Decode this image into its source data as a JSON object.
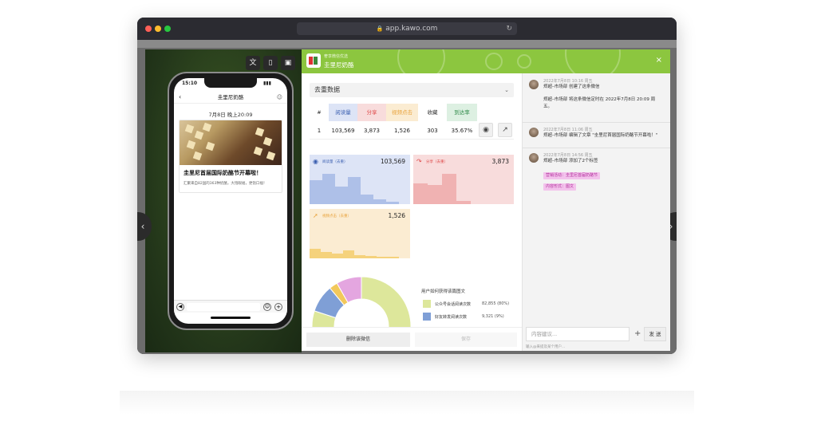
{
  "browser": {
    "url": "app.kawo.com",
    "dot_colors": [
      "#ff5f57",
      "#febc2e",
      "#28c840"
    ]
  },
  "toolbar": {
    "translate_icon": "translate-icon",
    "phone_icon": "phone-icon",
    "image_icon": "image-icon"
  },
  "phone": {
    "time": "15:10",
    "account_name": "圭里尼奶酪",
    "date_line": "7月8日 晚上20:09",
    "article_title": "圭里尼首届国际奶酪节开幕啦！",
    "article_desc": "汇聚来自82国的363种奶酪，大饱眼福，更饱口福！"
  },
  "modal": {
    "account_label": "奢享微信优选",
    "account_name": "圭里尼奶酪",
    "close": "×",
    "dedup_label": "去重数据",
    "table": {
      "headers": [
        "#",
        "阅读量",
        "分享",
        "视频点击",
        "收藏",
        "到达率"
      ],
      "row": [
        "1",
        "103,569",
        "3,873",
        "1,526",
        "303",
        "35.67%"
      ]
    },
    "cards": {
      "reads": {
        "label": "阅读量（去重）",
        "value": "103,569"
      },
      "shares": {
        "label": "分享（去重）",
        "value": "3,873"
      },
      "video": {
        "label": "视频点击（去重）",
        "value": "1,526"
      }
    },
    "donut": {
      "title": "用户如何获得该篇图文",
      "items": [
        {
          "name": "公众号会话阅读次数",
          "value": "82,855 (80%)",
          "color": "#dde79b"
        },
        {
          "name": "好友转发阅读次数",
          "value": "9,321 (9%)",
          "color": "#7f9fd6"
        }
      ]
    },
    "delete_label": "删除该微信",
    "save_label": "保存"
  },
  "log": [
    {
      "time": "2022年7月8日 10:16 周五",
      "line1": "郑超–市场部 创建了这条微信",
      "line2": "郑超–市场部 将这条微信定时在 2022年7月8日 20:09 周五。"
    },
    {
      "time": "2022年7月8日 11:06 周五",
      "line1": "郑超–市场部 编辑了文章 \"圭里尼首届国际奶酪节开幕啦！\""
    },
    {
      "time": "2022年7月8日 14:56 周五",
      "line1": "郑超–市场部 添加了2个标签",
      "tags": [
        "营销活动：圭里尼首届奶酪节",
        "内容形式：图文"
      ]
    }
  ],
  "comment": {
    "placeholder": "内容建议...",
    "plus": "+",
    "send": "发 送",
    "hint": "输入@来提及某个用户..."
  },
  "chart_data": [
    {
      "type": "pie",
      "title": "用户如何获得该篇图文",
      "categories": [
        "公众号会话阅读次数",
        "好友转发阅读次数"
      ],
      "values": [
        82855,
        9321
      ],
      "percent": [
        80,
        9
      ]
    }
  ]
}
